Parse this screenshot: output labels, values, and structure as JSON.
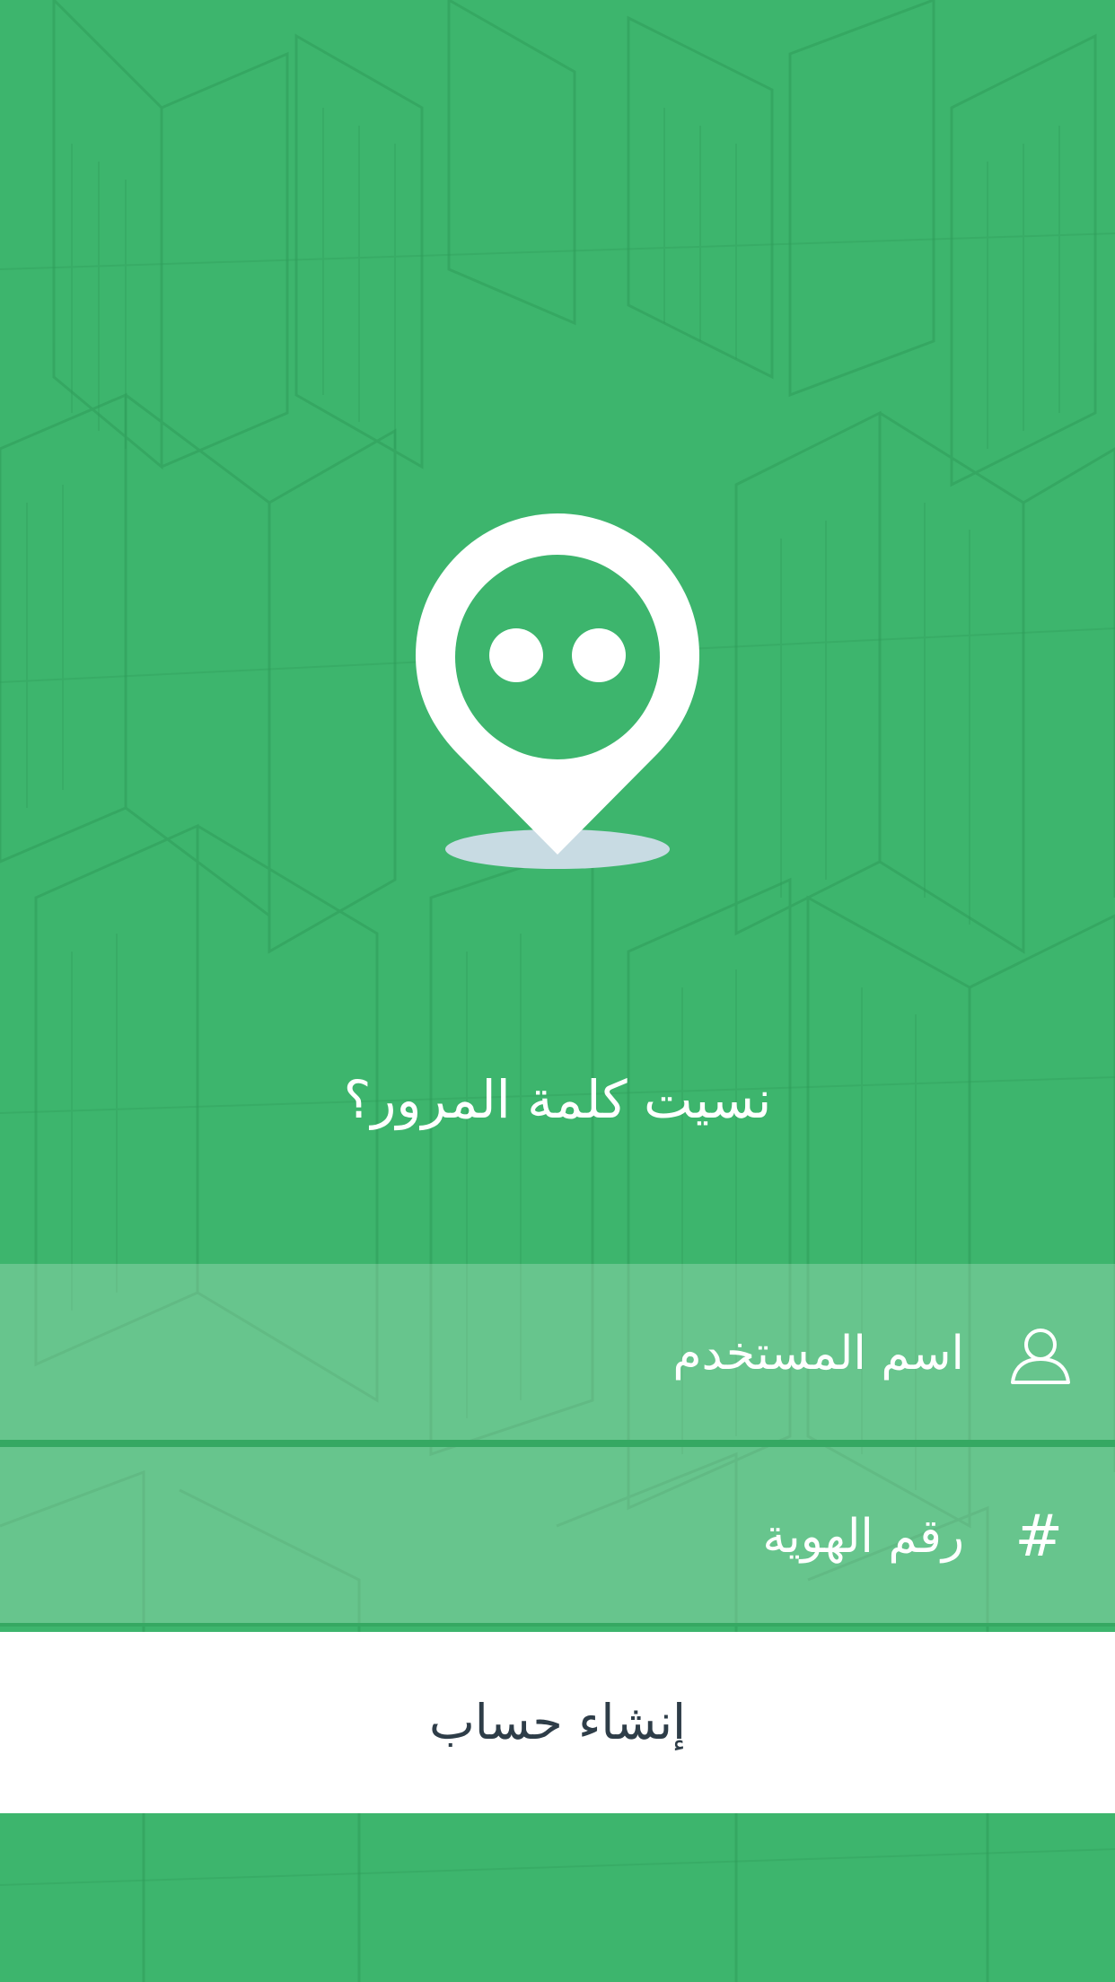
{
  "colors": {
    "background": "#3db56d",
    "field_overlay": "rgba(255,255,255,0.22)",
    "divider": "#35a862",
    "button_background": "#ffffff",
    "button_text": "#2e3d48",
    "text": "#ffffff"
  },
  "logo": {
    "icon": "location-pin-face-icon"
  },
  "screen_title": "نسيت كلمة المرور؟",
  "form": {
    "username": {
      "placeholder": "اسم المستخدم",
      "icon": "user-icon"
    },
    "id_number": {
      "placeholder": "رقم الهوية",
      "icon": "#"
    }
  },
  "create_account": {
    "label": "إنشاء حساب"
  }
}
